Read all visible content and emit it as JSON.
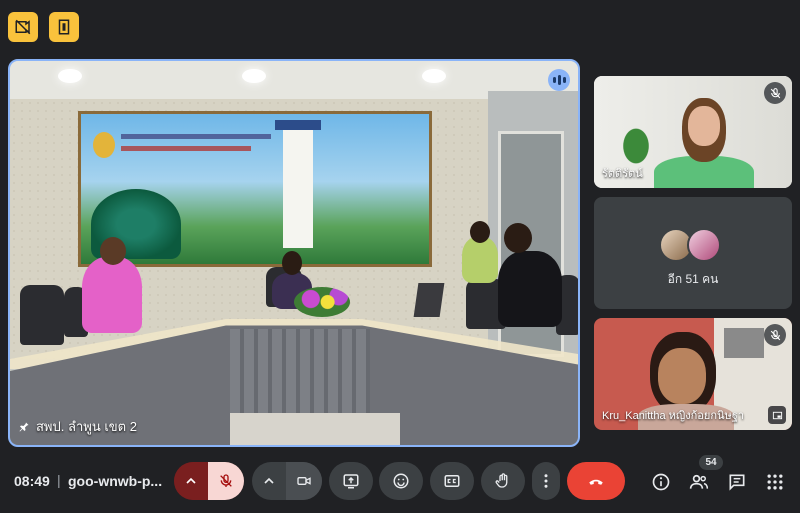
{
  "top_icons": [
    {
      "name": "no-video-layout-icon"
    },
    {
      "name": "door-exit-icon"
    }
  ],
  "main_tile": {
    "participant_name": "สพป. ลำพูน เขต 2",
    "speaking": true
  },
  "side_tiles": [
    {
      "name": "รัตติรัตน์",
      "muted": true
    },
    {
      "others_label": "อีก 51 คน"
    },
    {
      "name": "Kru_Kanittha หญิงก้อยกนิษฐา",
      "muted": true
    }
  ],
  "bottom_bar": {
    "time": "08:49",
    "separator": "|",
    "meeting_code": "goo-wnwb-p...",
    "participants_count": "54"
  },
  "colors": {
    "background": "#202124",
    "control": "#3c4043",
    "mic_off": "#f28b82",
    "end_call": "#ea4335",
    "accent_top": "#f9c23c",
    "speaking": "#8ab4f8"
  }
}
